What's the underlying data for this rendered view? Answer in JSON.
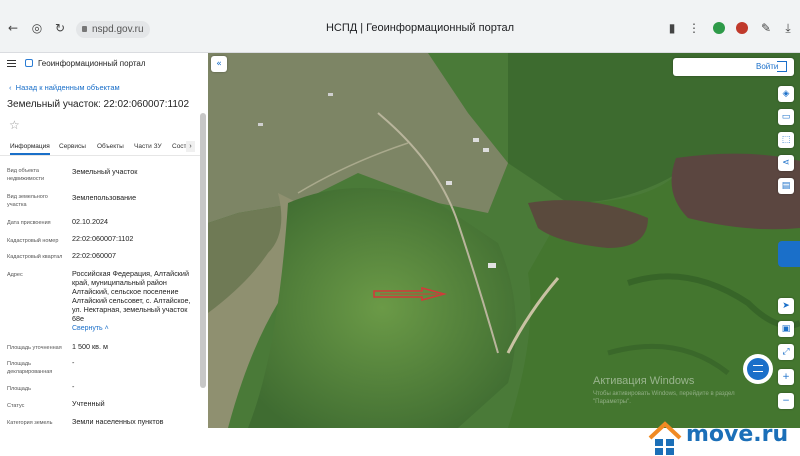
{
  "browser": {
    "url": "nspd.gov.ru",
    "tab_title": "НСПД | Геоинформационный портал"
  },
  "panel": {
    "portal_name": "Геоинформационный портал",
    "back_link": "Назад к найденным объектам",
    "object_title": "Земельный участок: 22:02:060007:1102",
    "tabs": [
      "Информация",
      "Сервисы",
      "Объекты",
      "Части ЗУ",
      "Сост"
    ],
    "active_tab": "Информация",
    "fields": [
      {
        "label": "Вид объекта недвижимости",
        "value": "Земельный участок"
      },
      {
        "label": "Вид земельного участка",
        "value": "Землепользование"
      },
      {
        "label": "Дата присвоения",
        "value": "02.10.2024"
      },
      {
        "label": "Кадастровый номер",
        "value": "22:02:060007:1102"
      },
      {
        "label": "Кадастровый квартал",
        "value": "22:02:060007"
      },
      {
        "label": "Адрес",
        "value": "Российская Федерация, Алтайский край, муниципальный район Алтайский, сельское поселение Алтайский сельсовет, с. Алтайское, ул. Нектарная, земельный участок 68е"
      },
      {
        "label": "Площадь уточненная",
        "value": "1 500 кв. м"
      },
      {
        "label": "Площадь декларированная",
        "value": "-"
      },
      {
        "label": "Площадь",
        "value": "-"
      },
      {
        "label": "Статус",
        "value": "Учтенный"
      },
      {
        "label": "Категория земель",
        "value": "Земли населенных пунктов"
      }
    ],
    "collapse_label": "Свернуть"
  },
  "map": {
    "login_label": "Войти",
    "watermark_title": "Активация Windows",
    "watermark_text": "Чтобы активировать Windows, перейдите в раздел \"Параметры\"."
  },
  "brand": {
    "site": "move.ru"
  },
  "colors": {
    "accent": "#1a6fc9",
    "marker": "#d23a3a"
  }
}
